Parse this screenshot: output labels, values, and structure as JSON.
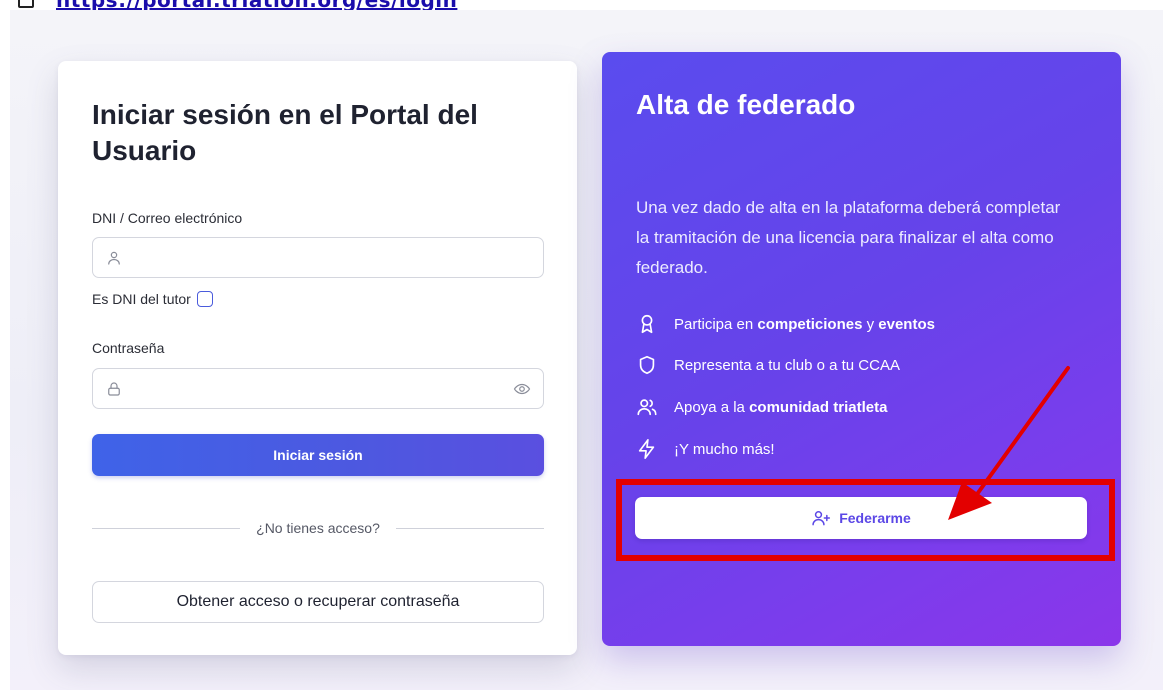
{
  "browser": {
    "url": "https://portal.triatlon.org/es/login"
  },
  "login": {
    "title": "Iniciar sesión en el Portal del Usuario",
    "user_label": "DNI / Correo electrónico",
    "user_value": "",
    "tutor_label": "Es DNI del tutor",
    "tutor_checked": false,
    "password_label": "Contraseña",
    "password_value": "",
    "submit_label": "Iniciar sesión",
    "divider_text": "¿No tienes acceso?",
    "access_label": "Obtener acceso o recuperar contraseña"
  },
  "federado": {
    "title": "Alta de federado",
    "description": "Una vez dado de alta en la plataforma deberá completar la tramitación de una licencia para finalizar el alta como federado.",
    "features": [
      {
        "icon": "award-icon",
        "pre": "Participa en ",
        "b1": "competiciones",
        "mid": " y ",
        "b2": "eventos"
      },
      {
        "icon": "shield-icon",
        "pre": "Representa a tu club o a tu CCAA",
        "b1": "",
        "mid": "",
        "b2": ""
      },
      {
        "icon": "users-icon",
        "pre": "Apoya a la ",
        "b1": "comunidad triatleta",
        "mid": "",
        "b2": ""
      },
      {
        "icon": "zap-icon",
        "pre": "¡Y mucho más!",
        "b1": "",
        "mid": "",
        "b2": ""
      }
    ],
    "button_label": "Federarme"
  },
  "colors": {
    "primary": "#4d58e0",
    "federado_bg": "#6643ea",
    "annotation_red": "#e30000"
  }
}
